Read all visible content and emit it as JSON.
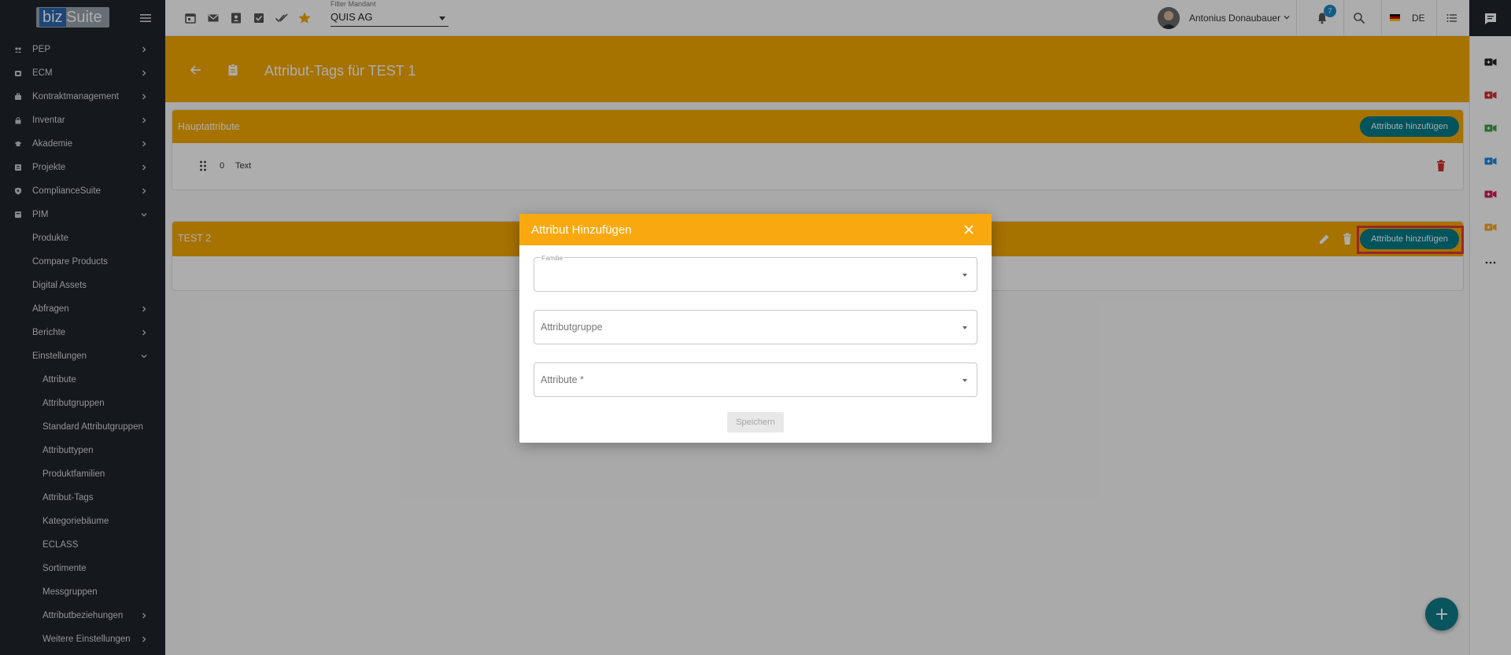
{
  "app": {
    "logo_biz": "biz",
    "logo_suite": "Suite"
  },
  "topbar": {
    "filter_label": "Filter Mandant",
    "filter_value": "QUIS AG",
    "user_name": "Antonius Donaubauer",
    "notifications": "7",
    "language": "DE",
    "icons": [
      "calendar-icon",
      "mail-icon",
      "contact-icon",
      "checkbox-icon",
      "done-all-icon",
      "star-icon"
    ]
  },
  "sidebar": {
    "items": [
      {
        "label": "PEP",
        "icon": "people-icon",
        "chevron": "right"
      },
      {
        "label": "ECM",
        "icon": "folder-icon",
        "chevron": "right"
      },
      {
        "label": "Kontraktmanagement",
        "icon": "briefcase-icon",
        "chevron": "right"
      },
      {
        "label": "Inventar",
        "icon": "lock-icon",
        "chevron": "right"
      },
      {
        "label": "Akademie",
        "icon": "school-icon",
        "chevron": "right"
      },
      {
        "label": "Projekte",
        "icon": "project-icon",
        "chevron": "right"
      },
      {
        "label": "ComplianceSuite",
        "icon": "shield-icon",
        "chevron": "right"
      },
      {
        "label": "PIM",
        "icon": "pim-icon",
        "chevron": "down"
      }
    ],
    "pim_children": [
      {
        "label": "Produkte",
        "chevron": ""
      },
      {
        "label": "Compare Products",
        "chevron": ""
      },
      {
        "label": "Digital Assets",
        "chevron": ""
      },
      {
        "label": "Abfragen",
        "chevron": "right"
      },
      {
        "label": "Berichte",
        "chevron": "right"
      },
      {
        "label": "Einstellungen",
        "chevron": "down"
      }
    ],
    "einstellungen_children": [
      {
        "label": "Attribute",
        "chevron": ""
      },
      {
        "label": "Attributgruppen",
        "chevron": ""
      },
      {
        "label": "Standard Attributgruppen",
        "chevron": ""
      },
      {
        "label": "Attributtypen",
        "chevron": ""
      },
      {
        "label": "Produktfamilien",
        "chevron": ""
      },
      {
        "label": "Attribut-Tags",
        "chevron": ""
      },
      {
        "label": "Kategoriebäume",
        "chevron": ""
      },
      {
        "label": "ECLASS",
        "chevron": ""
      },
      {
        "label": "Sortimente",
        "chevron": ""
      },
      {
        "label": "Messgruppen",
        "chevron": ""
      },
      {
        "label": "Attributbeziehungen",
        "chevron": "right"
      },
      {
        "label": "Weitere Einstellungen",
        "chevron": "right"
      }
    ]
  },
  "page": {
    "title": "Attribut-Tags für TEST 1",
    "sections": [
      {
        "title": "Hauptattribute",
        "button": "Attribute hinzufügen",
        "rows": [
          {
            "index": "0",
            "name": "Text"
          }
        ]
      },
      {
        "title": "TEST 2",
        "button": "Attribute hinzufügen",
        "rows": []
      }
    ]
  },
  "dialog": {
    "title": "Attribut Hinzufügen",
    "fields": [
      {
        "label": "Familie",
        "placeholder": ""
      },
      {
        "label": "",
        "placeholder": "Attributgruppe"
      },
      {
        "label": "",
        "placeholder": "Attribute *"
      }
    ],
    "save": "Speichern"
  },
  "right_strip": {
    "colors": [
      "#222222",
      "#d32f2f",
      "#43a047",
      "#1e88e5",
      "#d81b60",
      "#f9a825"
    ]
  },
  "colors": {
    "accent": "#f5a800",
    "teal": "#007c8a",
    "sidebar": "#1f242b",
    "highlight": "#e53935"
  }
}
